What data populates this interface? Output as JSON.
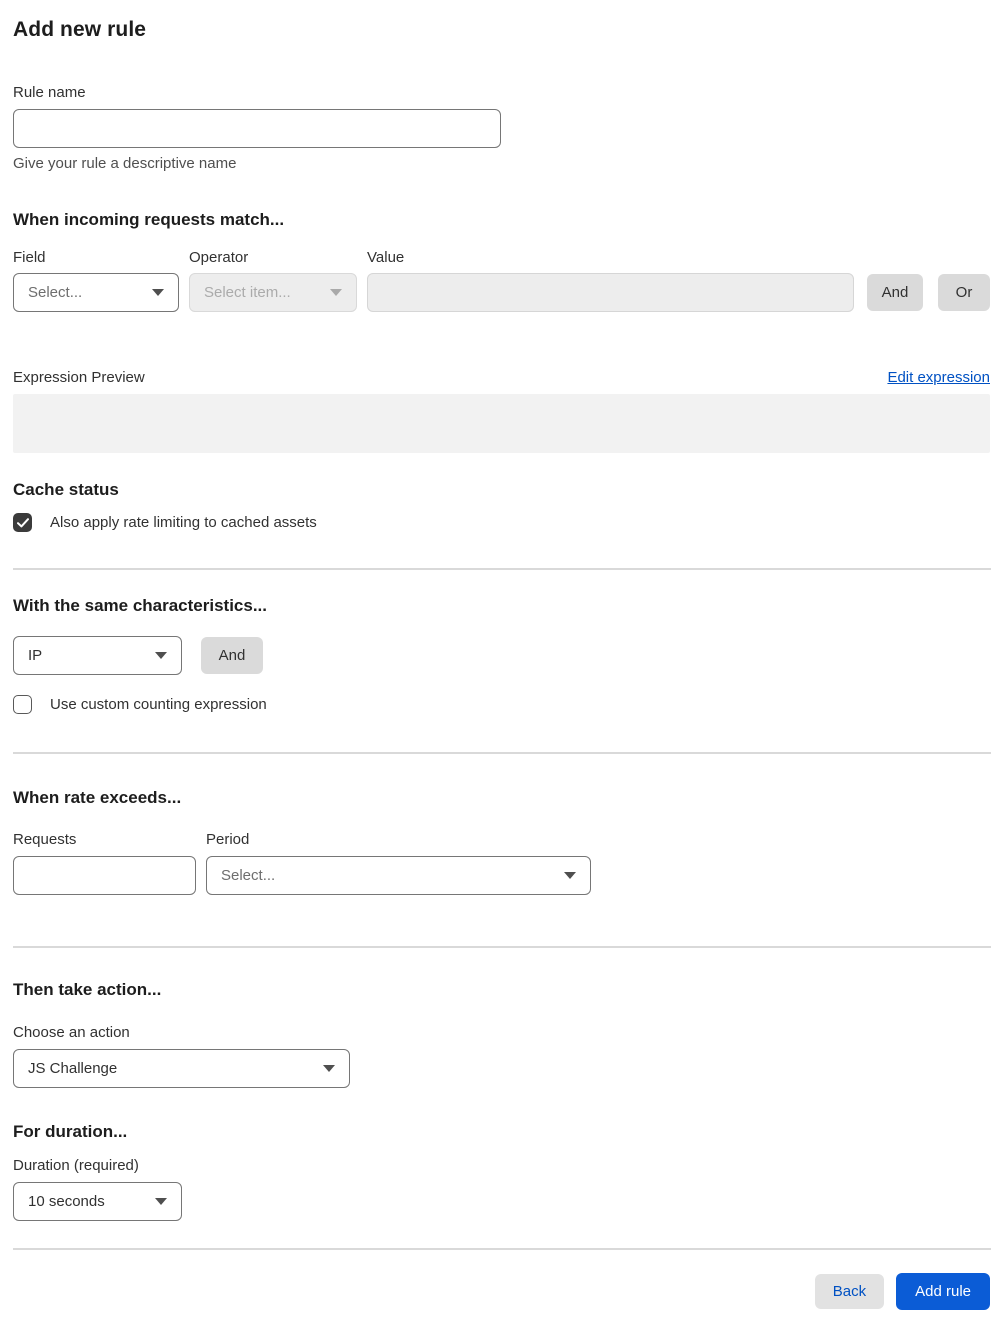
{
  "page": {
    "title": "Add new rule"
  },
  "rule_name": {
    "label": "Rule name",
    "value": "",
    "helper": "Give your rule a descriptive name"
  },
  "match_section": {
    "heading": "When incoming requests match...",
    "field": {
      "label": "Field",
      "selected": "Select...",
      "placeholder": true
    },
    "operator": {
      "label": "Operator",
      "selected": "Select item...",
      "disabled": true
    },
    "value": {
      "label": "Value",
      "value": "",
      "disabled": true
    },
    "and_button": "And",
    "or_button": "Or",
    "expression_preview_label": "Expression Preview",
    "edit_expression_link": "Edit expression",
    "expression_value": ""
  },
  "cache_status": {
    "heading": "Cache status",
    "checkbox_label": "Also apply rate limiting to cached assets",
    "checked": true
  },
  "characteristics": {
    "heading": "With the same characteristics...",
    "selected": "IP",
    "and_button": "And",
    "custom_counting_label": "Use custom counting expression",
    "custom_counting_checked": false
  },
  "rate": {
    "heading": "When rate exceeds...",
    "requests_label": "Requests",
    "requests_value": "",
    "period_label": "Period",
    "period_selected": "Select..."
  },
  "action": {
    "heading": "Then take action...",
    "choose_label": "Choose an action",
    "selected": "JS Challenge"
  },
  "duration": {
    "heading": "For duration...",
    "label": "Duration (required)",
    "selected": "10 seconds"
  },
  "footer": {
    "back_button": "Back",
    "add_rule_button": "Add rule"
  },
  "colors": {
    "link_blue": "#0051c3",
    "primary_button_blue": "#0b5cd6",
    "checked_checkbox": "#3b3b3b",
    "disabled_background": "#ededed",
    "divider_gray": "#d9d9d9",
    "expression_box_gray": "#f2f2f2",
    "gray_button": "#dadada"
  }
}
